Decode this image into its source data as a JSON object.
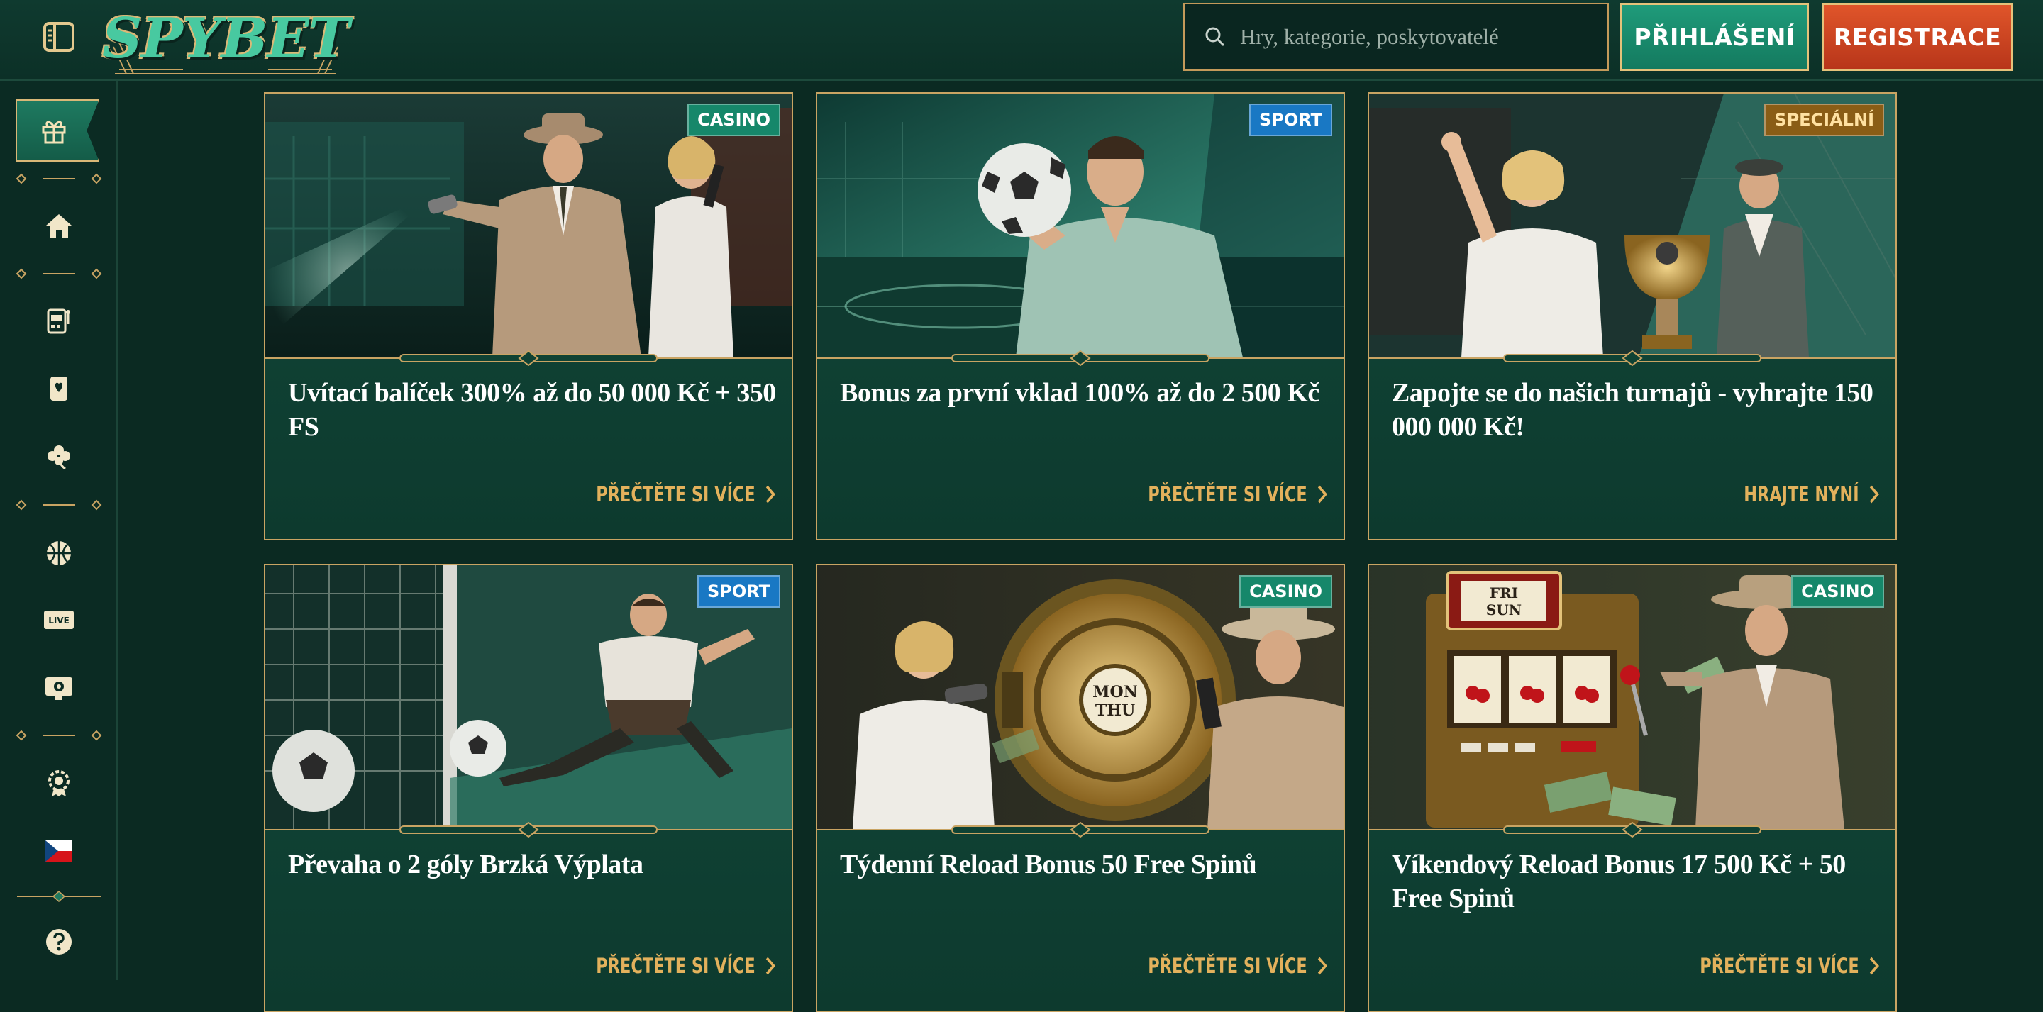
{
  "header": {
    "logo_text": "SPYBET",
    "search_placeholder": "Hry, kategorie, poskytovatelé",
    "login_label": "PŘIHLÁŠENÍ",
    "register_label": "REGISTRACE"
  },
  "sidebar": {
    "items": [
      {
        "name": "promotions",
        "icon": "gift-icon"
      },
      {
        "name": "home",
        "icon": "home-icon"
      },
      {
        "name": "slots",
        "icon": "slot-machine-icon"
      },
      {
        "name": "card-games",
        "icon": "playing-card-icon"
      },
      {
        "name": "lucky",
        "icon": "clover-icon"
      },
      {
        "name": "sport",
        "icon": "basketball-icon"
      },
      {
        "name": "live",
        "icon": "live-icon",
        "label": "LIVE"
      },
      {
        "name": "virtual-sport",
        "icon": "screen-ball-icon"
      },
      {
        "name": "loyalty",
        "icon": "award-badge-icon"
      },
      {
        "name": "language",
        "icon": "czech-flag-icon"
      },
      {
        "name": "help",
        "icon": "help-icon"
      }
    ]
  },
  "colors": {
    "background": "#0b2a22",
    "accent_gold": "#e3b15c",
    "login_green": "#1a8c6d",
    "register_orange": "#d44a22",
    "badge_casino": "#16876a",
    "badge_sport": "#1978c4",
    "badge_special": "#8a5d16"
  },
  "promotions": [
    {
      "badge": "CASINO",
      "title": "Uvítací balíček 300% až do 50 000 Kč + 350 FS",
      "cta": "PŘEČTĚTE SI VÍCE"
    },
    {
      "badge": "SPORT",
      "title": "Bonus za první vklad 100% až do 2 500 Kč",
      "cta": "PŘEČTĚTE SI VÍCE"
    },
    {
      "badge": "SPECIÁLNÍ",
      "title": "Zapojte se do našich turnajů - vyhrajte 150 000 000 Kč!",
      "cta": "HRAJTE NYNÍ"
    },
    {
      "badge": "SPORT",
      "title": "Převaha o 2 góly Brzká Výplata",
      "cta": "PŘEČTĚTE SI VÍCE"
    },
    {
      "badge": "CASINO",
      "title": "Týdenní Reload Bonus 50 Free Spinů",
      "cta": "PŘEČTĚTE SI VÍCE"
    },
    {
      "badge": "CASINO",
      "title": "Víkendový Reload Bonus 17 500 Kč + 50 Free Spinů",
      "cta": "PŘEČTĚTE SI VÍCE"
    }
  ],
  "image_texts": {
    "vault_dial_line1": "MON",
    "vault_dial_line2": "THU",
    "slot_sign_line1": "FRI",
    "slot_sign_line2": "SUN"
  }
}
